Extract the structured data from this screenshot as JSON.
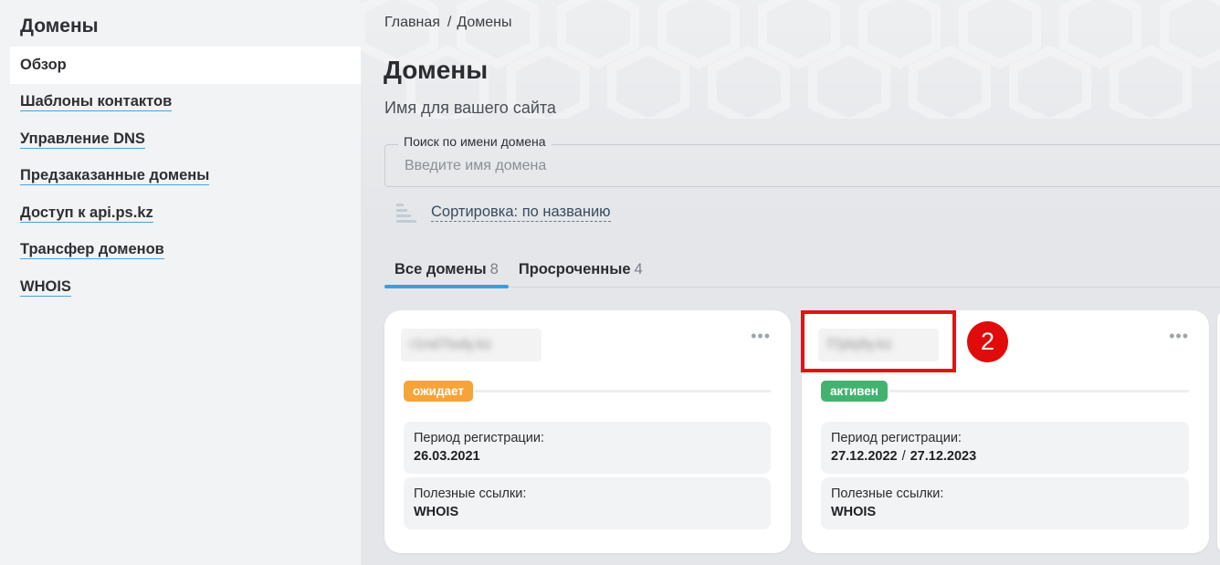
{
  "sidebar": {
    "title": "Домены",
    "items": [
      {
        "label": "Обзор",
        "active": true
      },
      {
        "label": "Шаблоны контактов"
      },
      {
        "label": "Управление DNS"
      },
      {
        "label": "Предзаказанные домены"
      },
      {
        "label": "Доступ к api.ps.kz"
      },
      {
        "label": "Трансфер доменов"
      },
      {
        "label": "WHOIS"
      }
    ]
  },
  "breadcrumb": {
    "home": "Главная",
    "separator": "/",
    "current": "Домены"
  },
  "page": {
    "title": "Домены",
    "subtitle": "Имя для вашего сайта"
  },
  "search": {
    "label": "Поиск по имени домена",
    "placeholder": "Введите имя домена",
    "value": ""
  },
  "sort": {
    "label": "Сортировка: по названию",
    "icon": "sort-icon"
  },
  "tabs": [
    {
      "label": "Все домены",
      "count": "8",
      "active": true
    },
    {
      "label": "Просроченные",
      "count": "4"
    }
  ],
  "cards": [
    {
      "domain": "r1nd7tsdy.kz",
      "status": "ожидает",
      "status_color": "#f6a33a",
      "period_label": "Период регистрации:",
      "period_start": "26.03.2021",
      "links_label": "Полезные ссылки:",
      "link": "WHOIS"
    },
    {
      "domain": "f7jdq9y.kz",
      "status": "активен",
      "status_color": "#43b26f",
      "period_label": "Период регистрации:",
      "period_start": "27.12.2022",
      "period_sep": "/",
      "period_end": "27.12.2023",
      "links_label": "Полезные ссылки:",
      "link": "WHOIS"
    }
  ],
  "annotation": {
    "step": "2",
    "color": "#e01414"
  },
  "colors": {
    "accent": "#3aa0d8",
    "link_underline": "#4aa3df"
  }
}
